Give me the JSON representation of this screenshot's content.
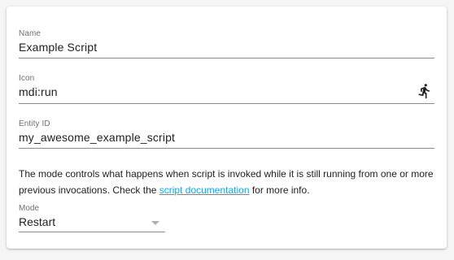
{
  "form": {
    "name": {
      "label": "Name",
      "value": "Example Script"
    },
    "icon": {
      "label": "Icon",
      "value": "mdi:run",
      "icon_name": "run-icon"
    },
    "entity_id": {
      "label": "Entity ID",
      "value": "my_awesome_example_script"
    },
    "description": {
      "before_link": "The mode controls what happens when script is invoked while it is still running from one or more previous invocations. Check the ",
      "link_text": "script documentation",
      "after_link": " for more info."
    },
    "mode": {
      "label": "Mode",
      "selected": "Restart"
    }
  },
  "colors": {
    "link": "#03a9f4",
    "text": "#212121",
    "label": "#6f6f6f",
    "underline": "#8c8c8c"
  }
}
